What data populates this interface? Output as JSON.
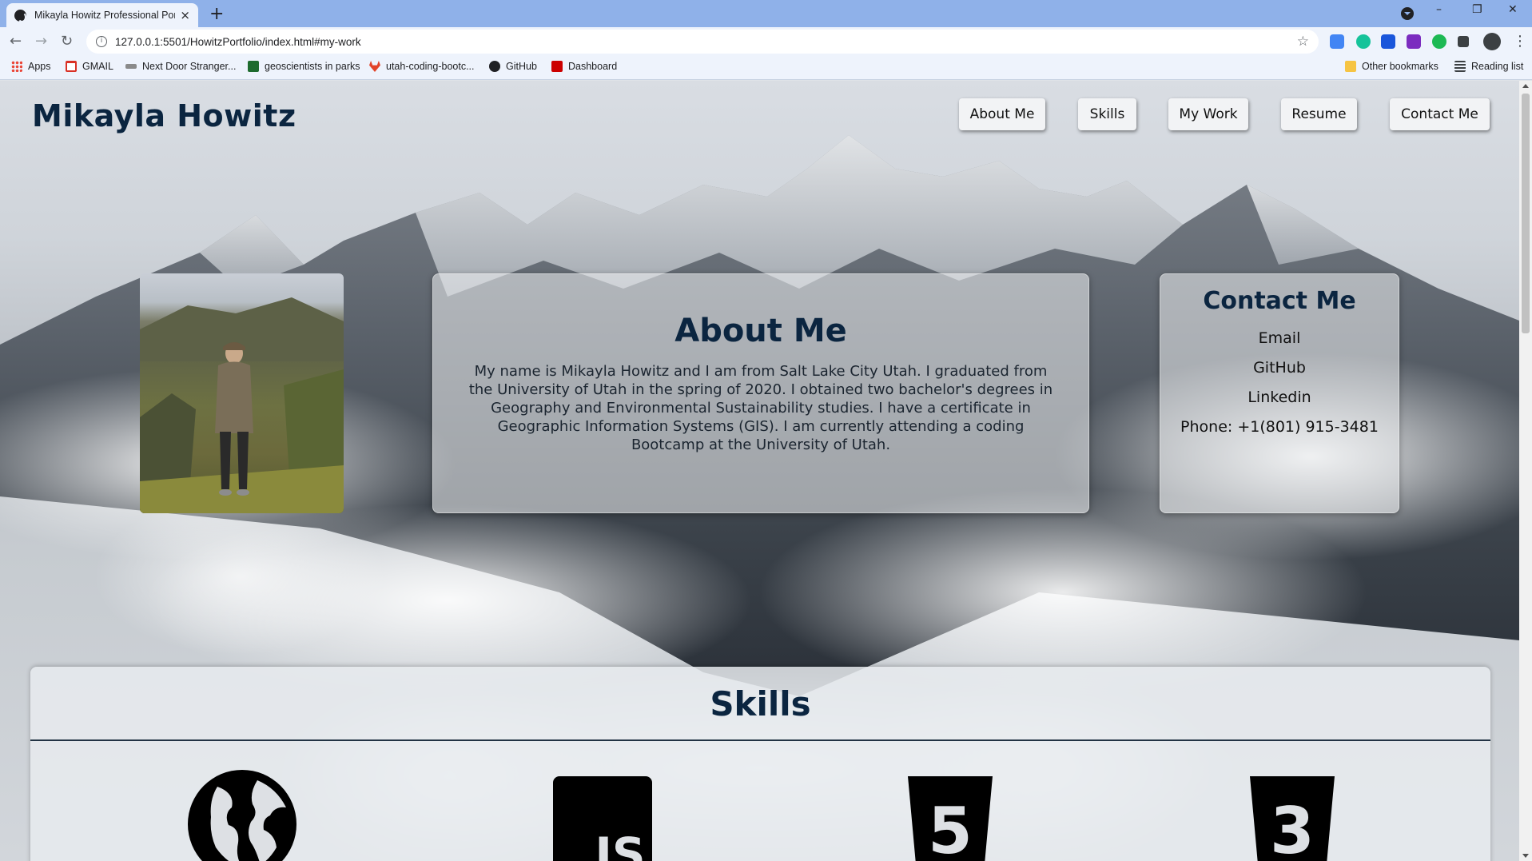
{
  "browser": {
    "tab_title": "Mikayla Howitz Professional Portfolio",
    "tab_close": "×",
    "new_tab": "+",
    "window_controls": {
      "minimize": "–",
      "restore": "❐",
      "close": "✕"
    },
    "nav": {
      "back": "←",
      "forward": "→",
      "reload": "↻"
    },
    "url": "127.0.0.1:5501/HowitzPortfolio/index.html#my-work",
    "info_glyph": "i",
    "star": "☆",
    "menu": "⋮",
    "bookmarks": [
      {
        "label": "Apps",
        "icon": "apps-grid-icon",
        "color": "#ea4335"
      },
      {
        "label": "GMAIL",
        "icon": "gmail-icon",
        "color": "#d93025"
      },
      {
        "label": "Next Door Stranger...",
        "icon": "nextdoor-icon",
        "color": "#8a8a8a"
      },
      {
        "label": "geoscientists in parks",
        "icon": "nps-icon",
        "color": "#1e6b2e"
      },
      {
        "label": "utah-coding-bootc...",
        "icon": "gitlab-icon",
        "color": "#e24329"
      },
      {
        "label": "GitHub",
        "icon": "github-icon",
        "color": "#202124"
      },
      {
        "label": "Dashboard",
        "icon": "utah-u-icon",
        "color": "#cc0000"
      }
    ],
    "other_bookmarks": "Other bookmarks",
    "reading_list": "Reading list"
  },
  "site": {
    "name": "Mikayla Howitz",
    "nav": [
      "About Me",
      "Skills",
      "My Work",
      "Resume",
      "Contact Me"
    ]
  },
  "about": {
    "heading": "About Me",
    "body": "My name is Mikayla Howitz and I am from Salt Lake City Utah. I graduated from the University of Utah in the spring of 2020. I obtained two bachelor's degrees in Geography and Environmental Sustainability studies. I have a certificate in Geographic Information Systems (GIS). I am currently attending a coding Bootcamp at the University of Utah."
  },
  "contact": {
    "heading": "Contact Me",
    "links": [
      "Email",
      "GitHub",
      "Linkedin"
    ],
    "phone": "Phone: +1(801) 915-3481"
  },
  "skills": {
    "heading": "Skills",
    "icons": [
      "globe-icon",
      "javascript-icon",
      "html5-icon",
      "css3-icon"
    ],
    "icon_labels": {
      "js": "JS",
      "html": "5",
      "css": "3"
    }
  },
  "colors": {
    "heading": "#0b2540",
    "tab_bar": "#8fb1e9",
    "toolbar": "#eef3fc"
  }
}
